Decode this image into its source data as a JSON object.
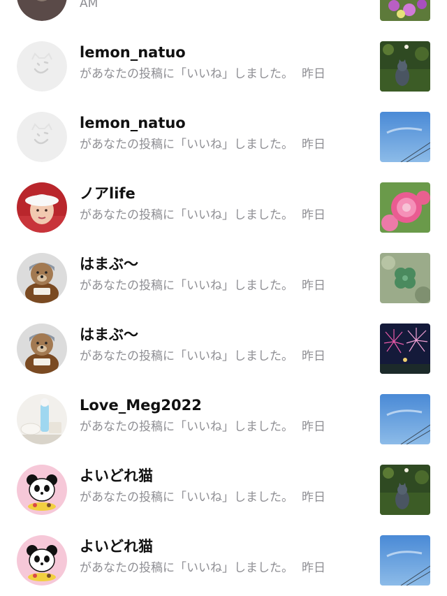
{
  "partial_row": {
    "time": "AM",
    "thumb_icon": "flower-garden-thumb"
  },
  "notifications": [
    {
      "username": "lemon_natuo",
      "message": "があなたの投稿に「いいね」しました。",
      "time": "昨日",
      "avatar": "default-avatar-icon",
      "thumb": "cat-thumb"
    },
    {
      "username": "lemon_natuo",
      "message": "があなたの投稿に「いいね」しました。",
      "time": "昨日",
      "avatar": "default-avatar-icon",
      "thumb": "sky-thumb"
    },
    {
      "username": "ノアlife",
      "message": "があなたの投稿に「いいね」しました。",
      "time": "昨日",
      "avatar": "woman-avatar",
      "thumb": "pink-rose-thumb"
    },
    {
      "username": "はまぶ〜",
      "message": "があなたの投稿に「いいね」しました。",
      "time": "昨日",
      "avatar": "teddy-bear-avatar",
      "thumb": "clover-thumb"
    },
    {
      "username": "はまぶ〜",
      "message": "があなたの投稿に「いいね」しました。",
      "time": "昨日",
      "avatar": "teddy-bear-avatar",
      "thumb": "fireworks-thumb"
    },
    {
      "username": "Love_Meg2022",
      "message": "があなたの投稿に「いいね」しました。",
      "time": "昨日",
      "avatar": "parfait-avatar",
      "thumb": "sky-thumb"
    },
    {
      "username": "よいどれ猫",
      "message": "があなたの投稿に「いいね」しました。",
      "time": "昨日",
      "avatar": "panda-avatar",
      "thumb": "cat-thumb"
    },
    {
      "username": "よいどれ猫",
      "message": "があなたの投稿に「いいね」しました。",
      "time": "昨日",
      "avatar": "panda-avatar",
      "thumb": "sky-thumb"
    }
  ]
}
